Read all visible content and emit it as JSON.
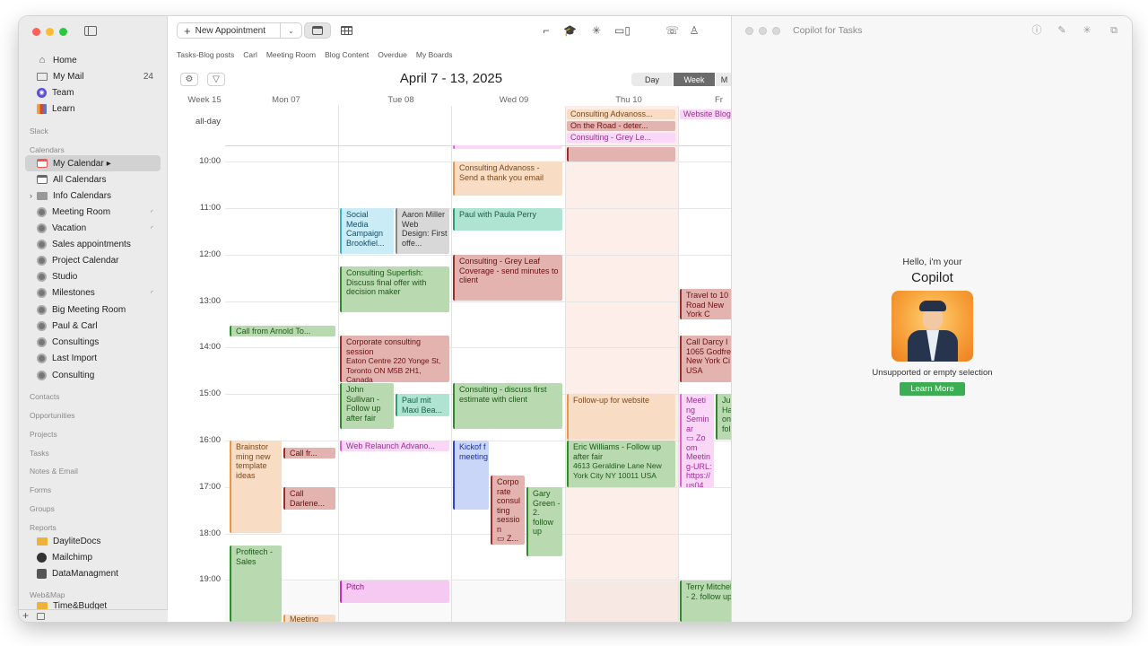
{
  "sidebar": {
    "items": [
      {
        "label": "Home",
        "icon": "home-icon"
      },
      {
        "label": "My Mail",
        "icon": "mail-icon",
        "count": "24"
      },
      {
        "label": "Team",
        "icon": "team-icon"
      },
      {
        "label": "Learn",
        "icon": "learn-icon"
      }
    ],
    "sections": {
      "slack": "Slack",
      "calendars": "Calendars",
      "contacts": "Contacts",
      "opportunities": "Opportunities",
      "projects": "Projects",
      "tasks": "Tasks",
      "notes_email": "Notes & Email",
      "forms": "Forms",
      "groups": "Groups",
      "reports": "Reports",
      "webmap": "Web&Map"
    },
    "calendars": [
      {
        "label": "My Calendar",
        "selected": true
      },
      {
        "label": "All Calendars"
      },
      {
        "label": "Info Calendars"
      },
      {
        "label": "Meeting Room",
        "feed": true
      },
      {
        "label": "Vacation",
        "feed": true
      },
      {
        "label": "Sales appointments"
      },
      {
        "label": "Project Calendar"
      },
      {
        "label": "Studio"
      },
      {
        "label": "Milestones",
        "feed": true
      },
      {
        "label": "Big Meeting Room"
      },
      {
        "label": "Paul & Carl"
      },
      {
        "label": "Consultings"
      },
      {
        "label": "Last Import"
      },
      {
        "label": "Consulting"
      }
    ],
    "reports": [
      {
        "label": "DayliteDocs"
      },
      {
        "label": "Mailchimp"
      },
      {
        "label": "DataManagment"
      }
    ],
    "webmap_item": "Time&Budget"
  },
  "toolbar": {
    "new_appointment": "New Appointment"
  },
  "favorites": [
    "Tasks-Blog posts",
    "Carl",
    "Meeting Room",
    "Blog Content",
    "Overdue",
    "My Boards"
  ],
  "calendar": {
    "range_title": "April 7 - 13, 2025",
    "view_day": "Day",
    "view_week": "Week",
    "view_month": "M",
    "week_label": "Week 15",
    "allday_label": "all-day",
    "days": [
      "Mon 07",
      "Tue 08",
      "Wed 09",
      "Thu 10",
      "Fr"
    ],
    "hours": [
      "10:00",
      "11:00",
      "12:00",
      "13:00",
      "14:00",
      "15:00",
      "16:00",
      "17:00",
      "18:00",
      "19:00"
    ],
    "allday_events": [
      {
        "title": "Consulting Advanoss..."
      },
      {
        "title": "On the Road - deter..."
      },
      {
        "title": "Consulting - Grey Le..."
      },
      {
        "title": "Website Blog"
      }
    ],
    "events": {
      "call_arnold": "Call from Arnold To...",
      "brainstorm": "Brainstor ming new template ideas",
      "call_fr": "Call fr...",
      "call_darlene": "Call Darlene...",
      "profitech": "Profitech - Sales",
      "meeting_mon": "Meeting",
      "social_media": "Social Media Campaign Brookfiel...",
      "aaron": "Aaron Miller Web Design: First offe...",
      "superfish": "Consulting Superfish: Discuss final offer with decision maker",
      "corporate": "Corporate consulting session",
      "corporate_addr": "Eaton Centre 220 Yonge St, Toronto ON M5B 2H1, Canada",
      "john": "John Sullivan - Follow up after fair",
      "paul_maxi": "Paul mit Maxi Bea...",
      "web_relaunch": "Web Relaunch Advano...",
      "pitch": "Pitch",
      "advanoss_thanks": "Consulting Advanoss - Send a thank you email",
      "paula": "Paul with Paula Perry",
      "greyleaf": "Consulting - Grey Leaf Coverage - send minutes to client",
      "discuss_estimate": "Consulting - discuss first estimate with client",
      "kickoff": "Kickof f meeting",
      "corp_session_wed": "Corpo rate consul ting sessio n",
      "corp_session_wed2": "Z...",
      "gary": "Gary Green - 2. follow up",
      "followup_website": "Follow-up for website",
      "eric": "Eric Williams - Follow up after fair",
      "eric_addr": "4613 Geraldine Lane New York City  NY 10011 USA",
      "travel": "Travel to 10 Road New York C",
      "darcy": "Call Darcy I 1065 Godfre New York Ci USA",
      "meeting_seminar": "Meeti ng Semin ar",
      "seminar_zoom": "Zo om Meetin g-URL: https:// us04...",
      "ju": "Ju Ha on fol",
      "terry": "Terry Mitchell - 2. follow up"
    }
  },
  "copilot": {
    "title": "Copilot for Tasks",
    "hello": "Hello, i'm your",
    "name": "Copilot",
    "unsupported": "Unsupported or empty selection",
    "learn_more": "Learn More"
  }
}
